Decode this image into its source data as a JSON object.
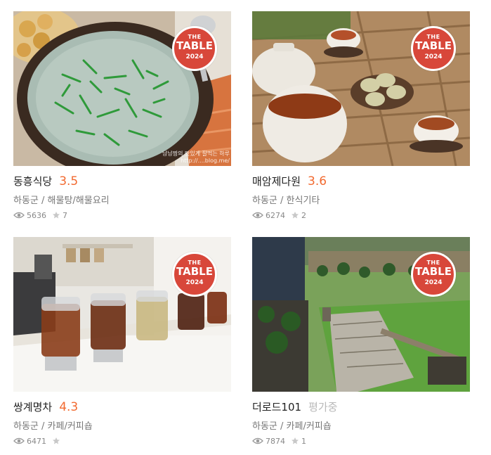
{
  "badge": {
    "line1": "THE",
    "line2": "TABLE",
    "line3": "2024",
    "color": "#d8473a"
  },
  "accent_color": "#f26a30",
  "restaurants": [
    {
      "name": "동흥식당",
      "score": "3.5",
      "category": "하동군 / 해물탕/해물요리",
      "views": "5636",
      "stars": "7",
      "watermark": "냠냠짱의 맛있게 잘먹는 하루\nhttp://....blog.me/",
      "photo": "soup"
    },
    {
      "name": "매암제다원",
      "score": "3.6",
      "category": "하동군 / 한식기타",
      "views": "6274",
      "stars": "2",
      "photo": "tea"
    },
    {
      "name": "쌍계명차",
      "score": "4.3",
      "category": "하동군 / 카페/커피숍",
      "views": "6471",
      "stars": "",
      "photo": "teashop"
    },
    {
      "name": "더로드101",
      "score": "평가중",
      "category": "하동군 / 카페/커피숍",
      "views": "7874",
      "stars": "1",
      "photo": "garden"
    }
  ],
  "icons": {
    "views": "eye-icon",
    "stars": "star-icon"
  }
}
